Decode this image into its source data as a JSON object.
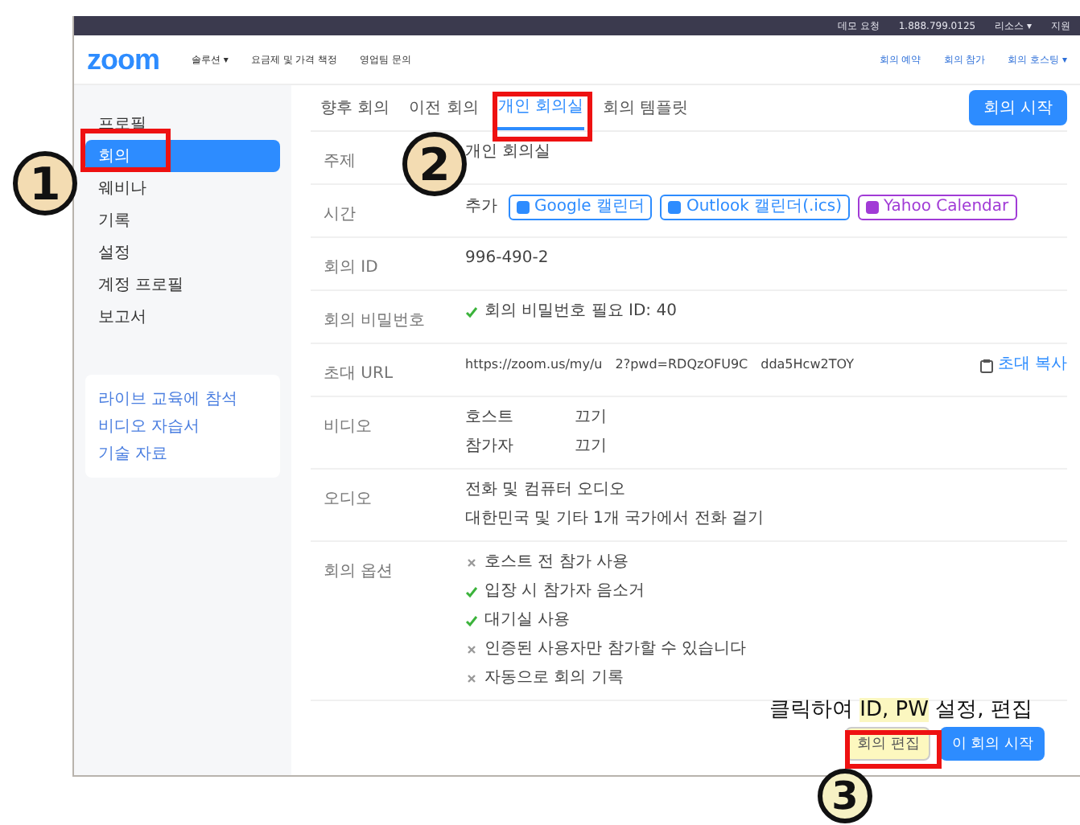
{
  "topbar": {
    "links": [
      "데모 요청",
      "1.888.799.0125",
      "리소스 ▾",
      "지원"
    ]
  },
  "header": {
    "logo": "zoom",
    "nav": [
      "솔루션 ▾",
      "요금제 및 가격 책정",
      "영업팀 문의"
    ],
    "actions": [
      "회의 예약",
      "회의 참가",
      "회의 호스팅 ▾"
    ]
  },
  "sidebar": {
    "items": [
      {
        "label": "프로필",
        "selected": false
      },
      {
        "label": "회의",
        "selected": true
      },
      {
        "label": "웨비나",
        "selected": false
      },
      {
        "label": "기록",
        "selected": false
      },
      {
        "label": "설정",
        "selected": false
      },
      {
        "label": "계정 프로필",
        "selected": false
      },
      {
        "label": "보고서",
        "selected": false
      }
    ],
    "links": [
      "라이브 교육에 참석",
      "비디오 자습서",
      "기술 자료"
    ]
  },
  "tabs": [
    {
      "label": "향후 회의",
      "selected": false
    },
    {
      "label": "이전 회의",
      "selected": false
    },
    {
      "label": "개인 회의실",
      "selected": true
    },
    {
      "label": "회의 템플릿",
      "selected": false
    }
  ],
  "start_button": "회의 시작",
  "fields": [
    {
      "label": "주제",
      "kind": "lines",
      "lines": [
        [
          "개인 회의실"
        ]
      ]
    },
    {
      "label": "시간",
      "kind": "calendar",
      "prefix": "추가",
      "buttons": [
        {
          "label": "Google 캘린더",
          "color": "#2d8cff"
        },
        {
          "label": "Outlook 캘린더(.ics)",
          "color": "#2d8cff"
        },
        {
          "label": "Yahoo Calendar",
          "color": "#a13bd6"
        }
      ]
    },
    {
      "label": "회의 ID",
      "kind": "lines",
      "lines": [
        [
          "996-490-2"
        ]
      ]
    },
    {
      "label": "회의 비밀번호",
      "kind": "options",
      "options": [
        {
          "text": "회의 비밀번호 필요  ID: 40",
          "checked": true
        }
      ]
    },
    {
      "label": "초대 URL",
      "kind": "url",
      "lines": [
        [
          "https://zoom.us/my/u",
          "2?pwd=RDQzOFU9C",
          "dda5Hcw2TOY"
        ]
      ],
      "action": "초대 복사"
    },
    {
      "label": "비디오",
      "kind": "lines",
      "lines": [
        [
          "호스트",
          "끄기"
        ],
        [
          "참가자",
          "끄기"
        ]
      ]
    },
    {
      "label": "오디오",
      "kind": "lines",
      "lines": [
        [
          "전화 및 컴퓨터 오디오"
        ],
        [
          "대한민국 및 기타 1개 국가에서 전화 걸기"
        ]
      ]
    },
    {
      "label": "회의 옵션",
      "kind": "options",
      "options": [
        {
          "text": "호스트 전 참가 사용",
          "checked": false
        },
        {
          "text": "입장 시 참가자 음소거",
          "checked": true
        },
        {
          "text": "대기실 사용",
          "checked": true
        },
        {
          "text": "인증된 사용자만 참가할 수 있습니다",
          "checked": false
        },
        {
          "text": "자동으로 회의 기록",
          "checked": false
        }
      ]
    }
  ],
  "footer_buttons": [
    {
      "label": "회의 편집",
      "kind": "secondary",
      "highlighted": true
    },
    {
      "label": "이 회의 시작",
      "kind": "primary",
      "highlighted": false
    }
  ],
  "note": [
    {
      "text": "클릭하여 ",
      "highlighted": false
    },
    {
      "text": "ID, PW",
      "highlighted": true
    },
    {
      "text": " 설정, 편집",
      "highlighted": false
    }
  ],
  "callouts": [
    {
      "number": "1"
    },
    {
      "number": "2"
    },
    {
      "number": "3"
    }
  ]
}
